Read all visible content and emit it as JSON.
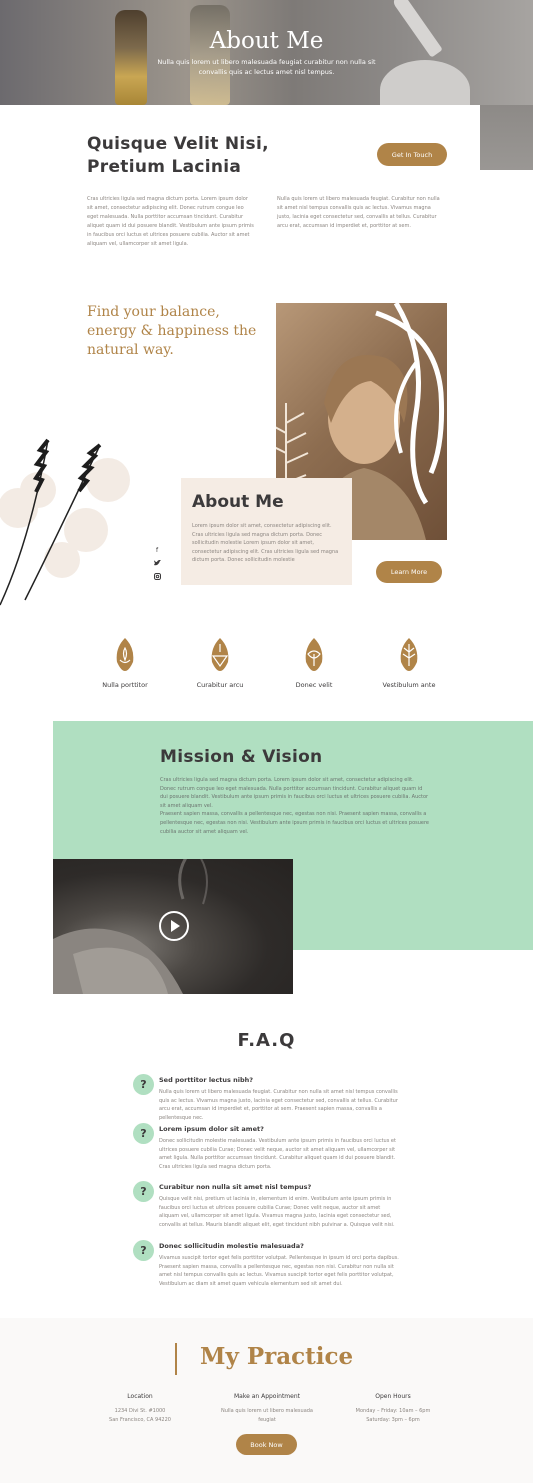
{
  "hero": {
    "title": "About Me",
    "subtitle": "Nulla quis lorem ut libero malesuada feugiat curabitur non nulla sit convallis quis ac lectus amet nisl tempus."
  },
  "intro": {
    "heading": "Quisque Velit Nisi, Pretium Lacinia",
    "button": "Get In Touch",
    "paragraph_left": "Cras ultricies ligula sed magna dictum porta. Lorem ipsum dolor sit amet, consectetur adipiscing elit. Donec rutrum congue leo eget malesuada. Nulla porttitor accumsan tincidunt. Curabitur aliquet quam id dui posuere blandit. Vestibulum ante ipsum primis in faucibus orci luctus et ultrices posuere cubilia. Auctor sit amet aliquam vel, ullamcorper sit amet ligula.",
    "paragraph_right": "Nulla quis lorem ut libero malesuada feugiat. Curabitur non nulla sit amet nisl tempus convallis quis ac lectus. Vivamus magna justo, lacinia eget consectetur sed, convallis at tellus. Curabitur arcu erat, accumsan id imperdiet et, porttitor at sem."
  },
  "balance": {
    "tagline": "Find your balance, energy & happiness the natural way."
  },
  "about_card": {
    "title": "About Me",
    "text": "Lorem ipsum dolor sit amet, consectetur adipiscing elit. Cras ultricies ligula sed magna dictum porta. Donec sollicitudin molestie Lorem ipsum dolor sit amet, consectetur adipiscing elit. Cras ultricies ligula sed magna dictum porta. Donec sollicitudin molestie",
    "button": "Learn More"
  },
  "social": [
    "facebook-icon",
    "twitter-icon",
    "instagram-icon"
  ],
  "features": [
    {
      "label": "Nulla porttitor",
      "icon": "lotus-leaf-icon"
    },
    {
      "label": "Curabitur arcu",
      "icon": "incense-leaf-icon"
    },
    {
      "label": "Donec velit",
      "icon": "flower-leaf-icon"
    },
    {
      "label": "Vestibulum ante",
      "icon": "leaf-icon"
    }
  ],
  "mission": {
    "title": "Mission & Vision",
    "text1": "Cras ultricies ligula sed magna dictum porta. Lorem ipsum dolor sit amet, consectetur adipiscing elit. Donec rutrum congue leo eget malesuada. Nulla porttitor accumsan tincidunt. Curabitur aliquet quam id dui posuere blandit. Vestibulum ante ipsum primis in faucibus orci luctus et ultrices posuere cubilia. Auctor sit amet aliquam vel.",
    "text2": "Praesent sapien massa, convallis a pellentesque nec, egestas non nisi. Praesent sapien massa, convallis a pellentesque nec, egestas non nisi. Vestibulum ante ipsum primis in faucibus orci luctus et ultrices posuere cubilia auctor sit amet aliquam vel."
  },
  "faq": {
    "title": "F.A.Q",
    "items": [
      {
        "q": "Sed porttitor lectus nibh?",
        "a": "Nulla quis lorem ut libero malesuada feugiat. Curabitur non nulla sit amet nisl tempus convallis quis ac lectus. Vivamus magna justo, lacinia eget consectetur sed, convallis at tellus. Curabitur arcu erat, accumsan id imperdiet et, porttitor at sem. Praesent sapien massa, convallis a pellentesque nec."
      },
      {
        "q": "Lorem ipsum dolor sit amet?",
        "a": "Donec sollicitudin molestie malesuada. Vestibulum ante ipsum primis in faucibus orci luctus et ultrices posuere cubilia Curae; Donec velit neque, auctor sit amet aliquam vel, ullamcorper sit amet ligula. Nulla porttitor accumsan tincidunt. Curabitur aliquet quam id dui posuere blandit. Cras ultricies ligula sed magna dictum porta."
      },
      {
        "q": "Curabitur non nulla sit amet nisl tempus?",
        "a": "Quisque velit nisi, pretium ut lacinia in, elementum id enim. Vestibulum ante ipsum primis in faucibus orci luctus et ultrices posuere cubilia Curae; Donec velit neque, auctor sit amet aliquam vel, ullamcorper sit amet ligula. Vivamus magna justo, lacinia eget consectetur sed, convallis at tellus. Mauris blandit aliquet elit, eget tincidunt nibh pulvinar a. Quisque velit nisi."
      },
      {
        "q": "Donec sollicitudin molestie malesuada?",
        "a": "Vivamus suscipit tortor eget felis porttitor volutpat. Pellentesque in ipsum id orci porta dapibus. Praesent sapien massa, convallis a pellentesque nec, egestas non nisi. Curabitur non nulla sit amet nisl tempus convallis quis ac lectus. Vivamus suscipit tortor eget felis porttitor volutpat, Vestibulum ac diam sit amet quam vehicula elementum sed sit amet dui."
      }
    ]
  },
  "practice": {
    "title": "My Practice",
    "location_h": "Location",
    "location_l1": "1234 Divi St. #1000",
    "location_l2": "San Francisco, CA 94220",
    "appt_h": "Make an Appointment",
    "appt_l1": "Nulla quis lorem ut libero malesuada",
    "appt_l2": "feugiat",
    "hours_h": "Open Hours",
    "hours_l1": "Monday – Friday: 10am – 6pm",
    "hours_l2": "Saturday: 3pm – 6pm",
    "button": "Book Now"
  },
  "colors": {
    "accent": "#b08448",
    "mint": "#b0dfc1",
    "heading": "#3c3a3b",
    "card": "#f5ece4"
  }
}
